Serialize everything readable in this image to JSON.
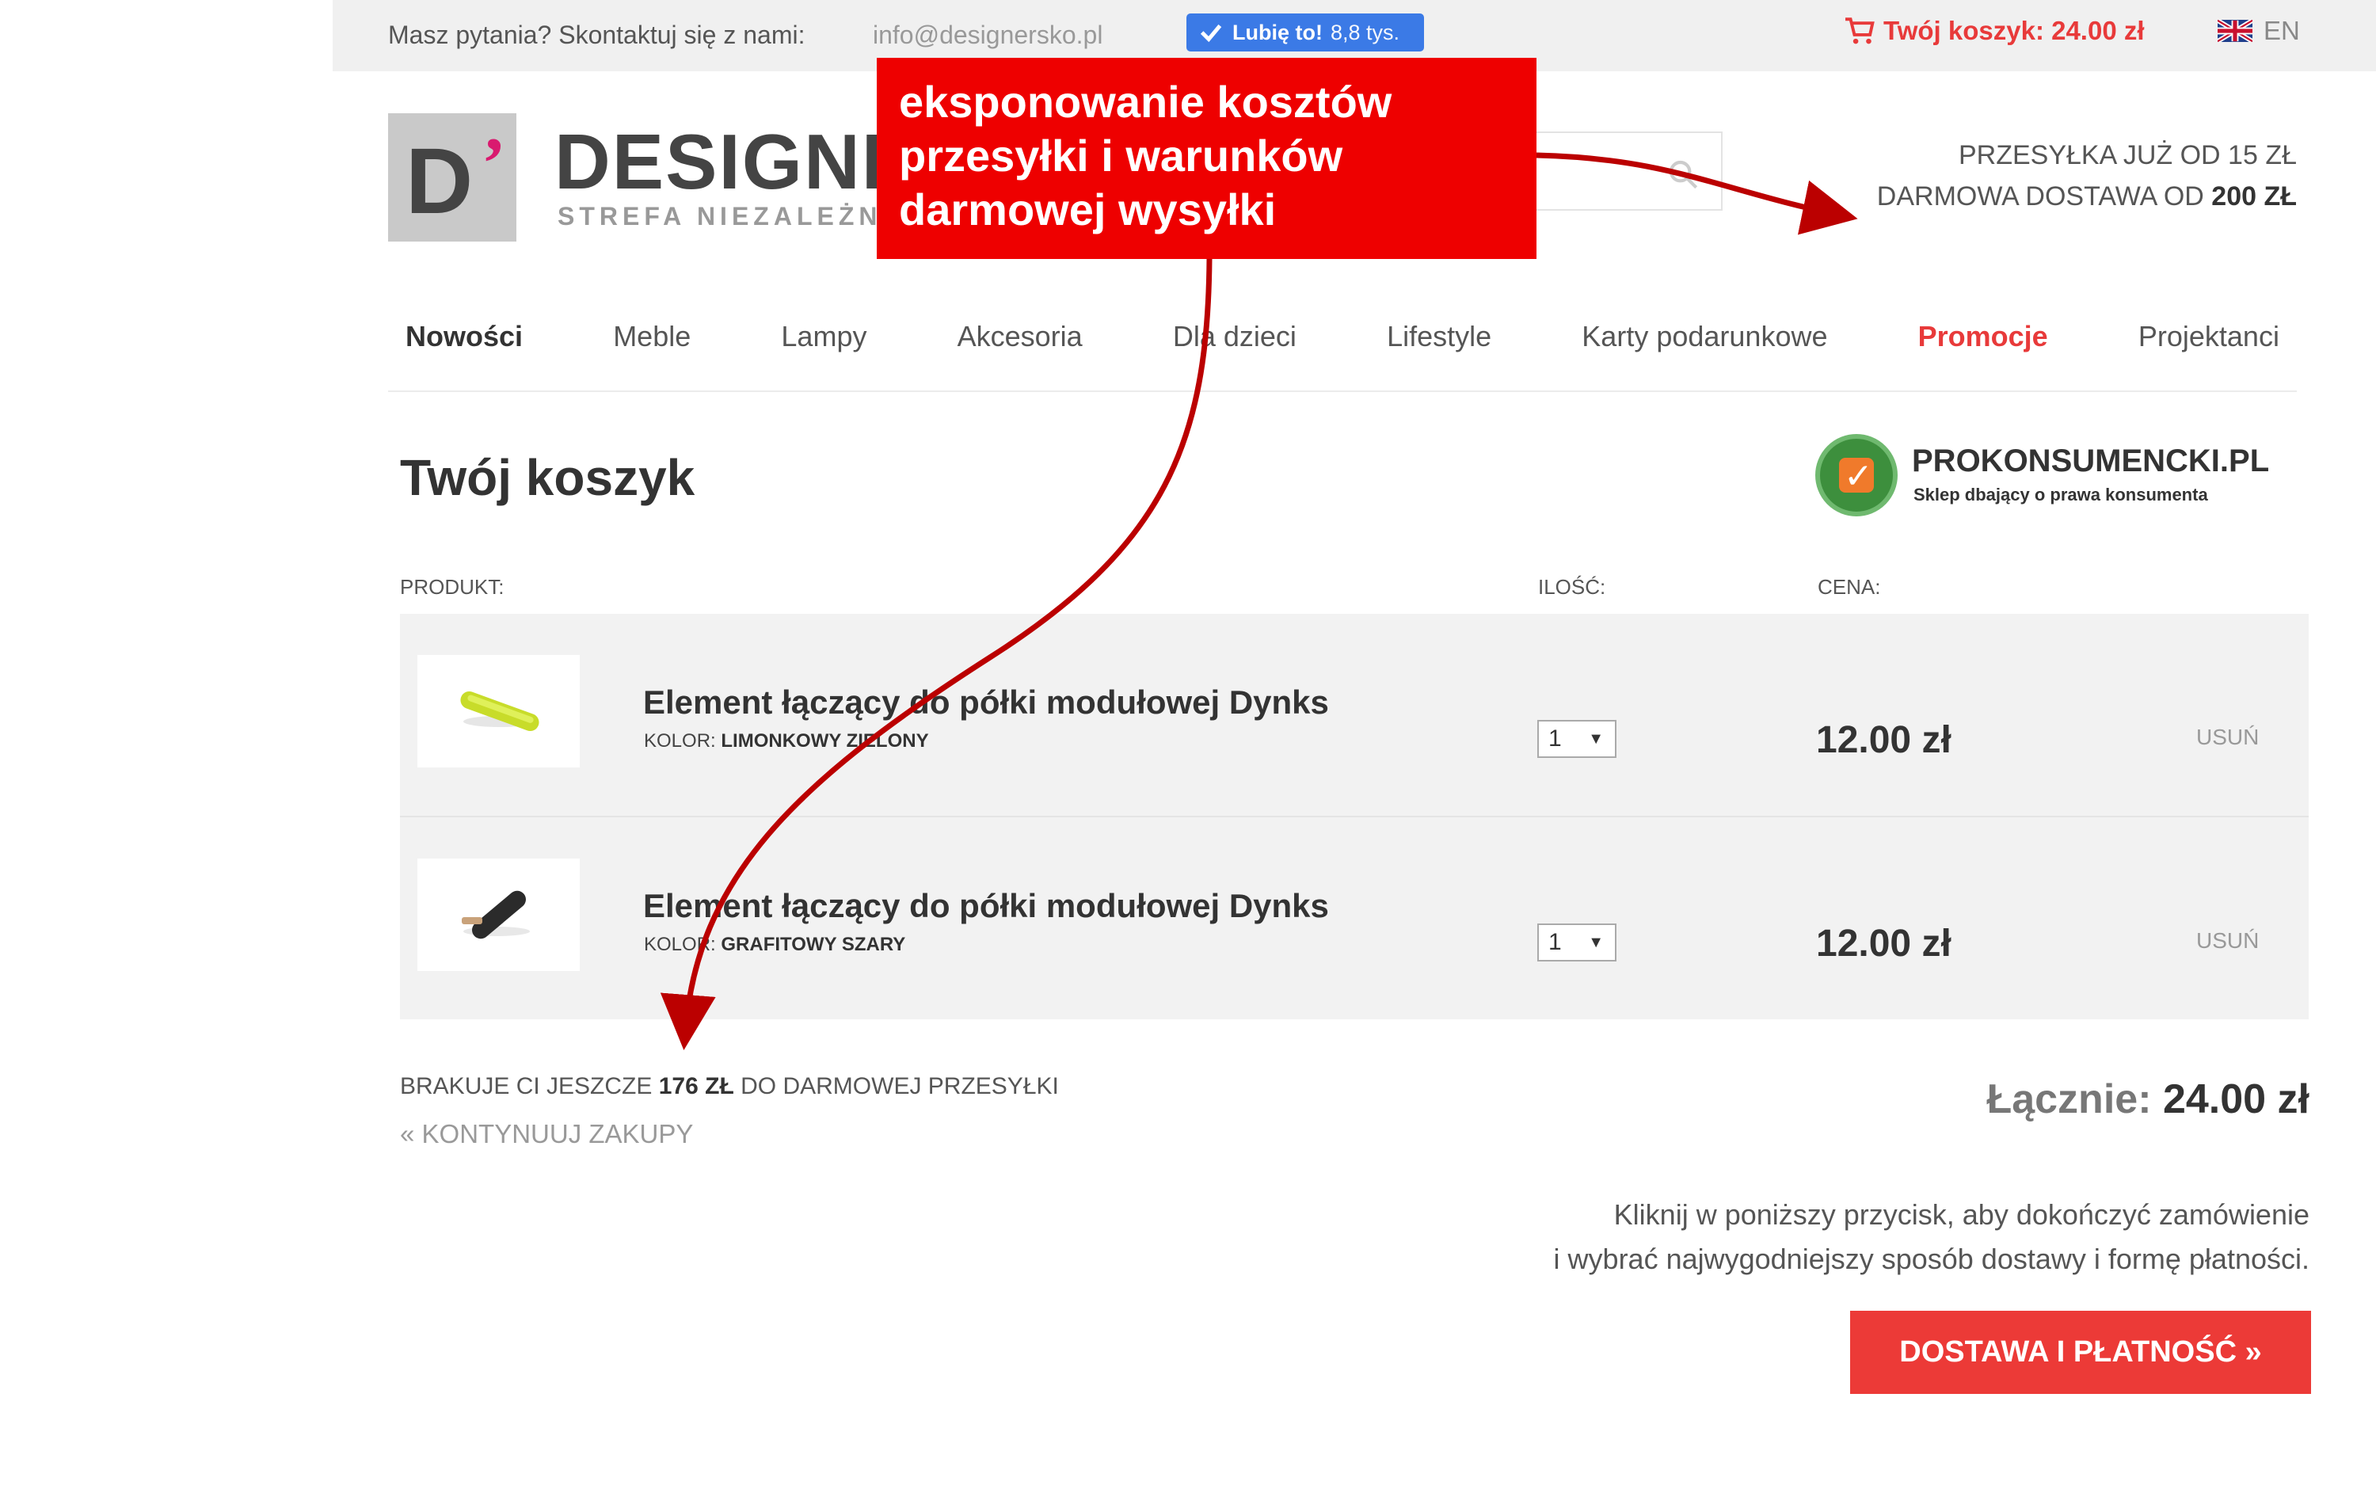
{
  "topbar": {
    "contact_label": "Masz pytania? Skontaktuj się z nami:",
    "email": "info@designersko.pl",
    "fb_like_label": "Lubię to!",
    "fb_like_count": "8,8 tys.",
    "cart_label": "Twój koszyk: 24.00 zł",
    "language": "EN"
  },
  "header": {
    "logo_letter": "D",
    "logo_apostrophe": "’",
    "logo_word": "DESIGNEI",
    "logo_subtitle": "STREFA NIEZALEŻNEG",
    "shipping_line1": "PRZESYŁKA JUŻ OD 15 ZŁ",
    "shipping_line2_prefix": "DARMOWA DOSTAWA OD",
    "shipping_line2_amount": "200 ZŁ"
  },
  "nav": {
    "items": [
      "Nowości",
      "Meble",
      "Lampy",
      "Akcesoria",
      "Dla dzieci",
      "Lifestyle",
      "Karty podarunkowe",
      "Promocje",
      "Projektanci"
    ]
  },
  "cart": {
    "title": "Twój koszyk",
    "badge_name": "PROKONSUMENCKI.PL",
    "badge_tagline": "Sklep dbający o prawa konsumenta",
    "columns": {
      "product": "PRODUKT:",
      "quantity": "ILOŚĆ:",
      "price": "CENA:"
    },
    "items": [
      {
        "name": "Element łączący do półki modułowej Dynks",
        "option_label": "KOLOR:",
        "option_value": "LIMONKOWY ZIELONY",
        "quantity": "1",
        "price": "12.00 zł",
        "remove_label": "USUŃ",
        "thumb_color": "#c8dc2a"
      },
      {
        "name": "Element łączący do półki modułowej Dynks",
        "option_label": "KOLOR:",
        "option_value": "GRAFITOWY SZARY",
        "quantity": "1",
        "price": "12.00 zł",
        "remove_label": "USUŃ",
        "thumb_color": "#333333"
      }
    ],
    "missing_prefix": "BRAKUJE CI JESZCZE",
    "missing_amount": "176 ZŁ",
    "missing_suffix": "DO DARMOWEJ PRZESYŁKI",
    "continue_label": "« KONTYNUUJ ZAKUPY",
    "total_label": "Łącznie:",
    "total_amount": "24.00 zł",
    "note_line1": "Kliknij w poniższy przycisk, aby dokończyć zamówienie",
    "note_line2": "i wybrać najwygodniejszy sposób dostawy i formę płatności.",
    "checkout_label": "DOSTAWA I PŁATNOŚĆ »"
  },
  "annotation": {
    "line1": "eksponowanie kosztów",
    "line2": "przesyłki i warunków",
    "line3": "darmowej wysyłki",
    "color": "#ee0000",
    "arrow_color": "#bb0000"
  }
}
